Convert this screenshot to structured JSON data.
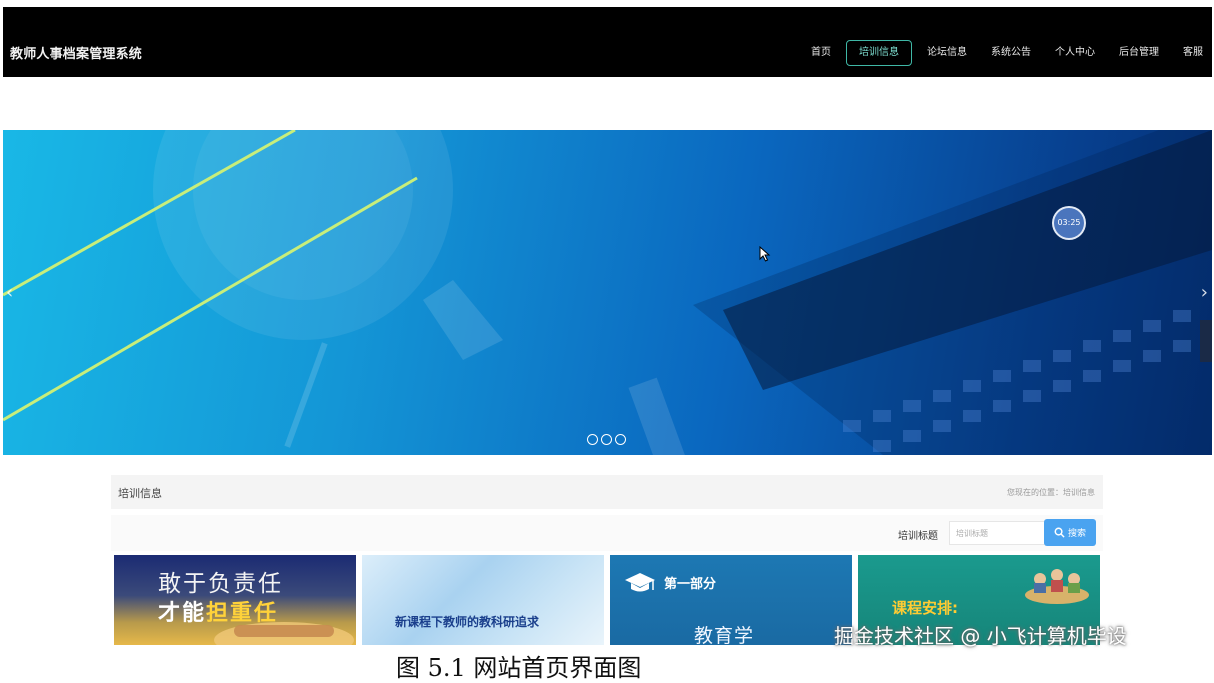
{
  "app": {
    "title": "教师人事档案管理系统"
  },
  "nav": {
    "items": [
      {
        "label": "首页",
        "active": false
      },
      {
        "label": "培训信息",
        "active": true
      },
      {
        "label": "论坛信息",
        "active": false
      },
      {
        "label": "系统公告",
        "active": false
      },
      {
        "label": "个人中心",
        "active": false
      },
      {
        "label": "后台管理",
        "active": false
      },
      {
        "label": "客服",
        "active": false
      }
    ],
    "accent_color": "#3fb7a6"
  },
  "banner": {
    "timer_badge": "03:25",
    "slides_count": 3,
    "prev_icon": "chevron-left-icon",
    "next_icon": "chevron-right-icon"
  },
  "section": {
    "title": "培训信息",
    "breadcrumb": "您现在的位置：培训信息"
  },
  "search": {
    "label": "培训标题",
    "placeholder": "培训标题",
    "button_label": "搜索",
    "button_icon": "search-icon",
    "button_color": "#4aa3f0"
  },
  "cards": [
    {
      "line1": "敢于负责任",
      "line2_pre": "才能",
      "line2_hl": "担重任"
    },
    {
      "text": "新课程下教师的教科研追求"
    },
    {
      "header": "第一部分",
      "title": "教育学"
    },
    {
      "text": "课程安排:"
    }
  ],
  "watermark": "掘金技术社区 @ 小飞计算机毕设",
  "caption": "图 5.1 网站首页界面图"
}
